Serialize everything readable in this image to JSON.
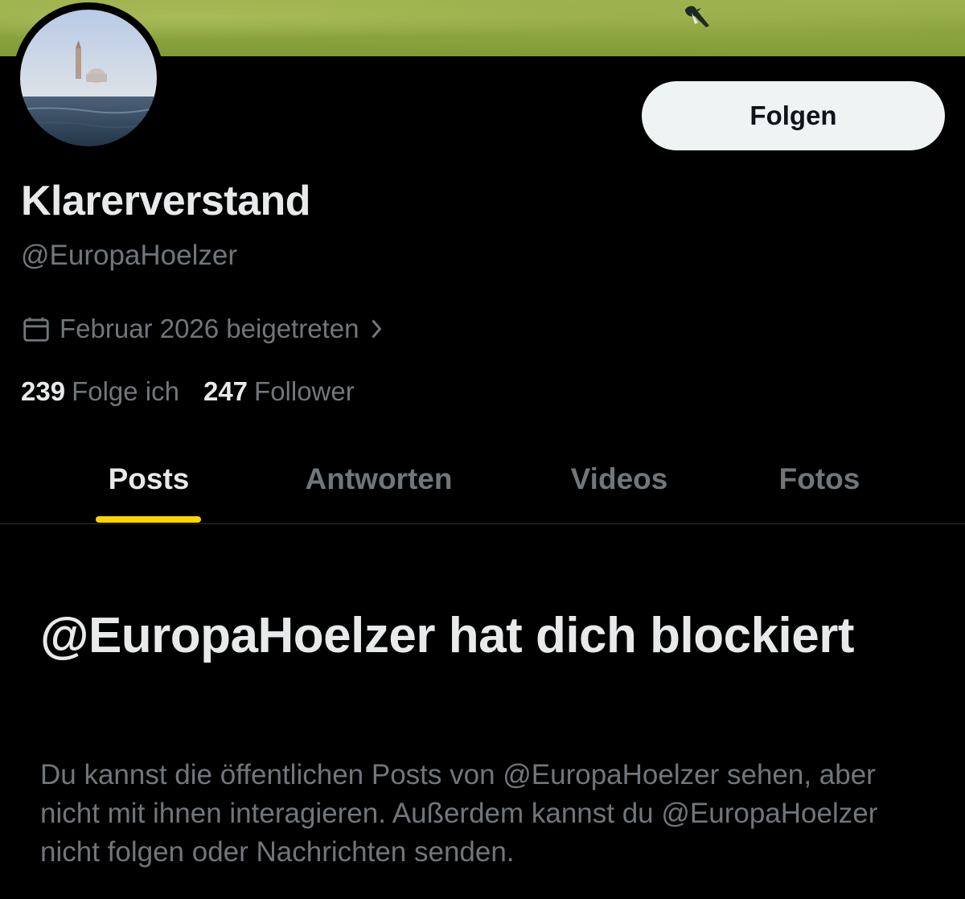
{
  "profile": {
    "display_name": "Klarerverstand",
    "handle": "@EuropaHoelzer",
    "joined": "Februar 2026 beigetreten",
    "following_count": "239",
    "following_label": "Folge ich",
    "followers_count": "247",
    "followers_label": "Follower"
  },
  "actions": {
    "follow_label": "Folgen"
  },
  "tabs": [
    {
      "label": "Posts"
    },
    {
      "label": "Antworten"
    },
    {
      "label": "Videos"
    },
    {
      "label": "Fotos"
    }
  ],
  "active_tab": "Posts",
  "blocked_notice": {
    "title": "@EuropaHoelzer hat dich blockiert",
    "description": "Du kannst die öffentlichen Posts von @EuropaHoelzer sehen, aber nicht mit ihnen interagieren. Außerdem kannst du @EuropaHoelzer nicht folgen oder Nachrichten senden."
  },
  "colors": {
    "background": "#000000",
    "primary_text": "#e7e9ea",
    "secondary_text": "#71767b",
    "tab_accent": "#ffd400",
    "follow_button_bg": "#eff3f4"
  },
  "icons": {
    "joined": "calendar-icon",
    "joined_more": "chevron-right-icon"
  }
}
